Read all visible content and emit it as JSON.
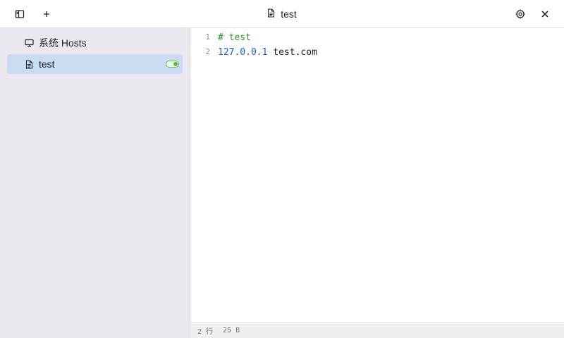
{
  "window": {
    "title": "test",
    "title_icon": "file-icon",
    "buttons": {
      "sidebar_toggle": "sidebar-toggle-icon",
      "add": "plus-icon",
      "settings": "gear-icon",
      "close": "close-icon"
    }
  },
  "sidebar": {
    "items": [
      {
        "label": "系统 Hosts",
        "icon": "monitor-icon",
        "active": false
      },
      {
        "label": "test",
        "icon": "file-icon",
        "active": true,
        "enabled": true
      }
    ]
  },
  "editor": {
    "lines": [
      {
        "num": "1",
        "comment": "# test"
      },
      {
        "num": "2",
        "ip": "127.0.0.1",
        "host": " test.com"
      }
    ]
  },
  "status": {
    "lines": "2 行",
    "size": "25 B"
  },
  "colors": {
    "sidebar_bg": "#ebe8ef",
    "active_item_bg": "#cbdcf2",
    "comment": "#2e9a2e",
    "ip": "#1d5fc4",
    "toggle_on": "#5fb84a"
  }
}
